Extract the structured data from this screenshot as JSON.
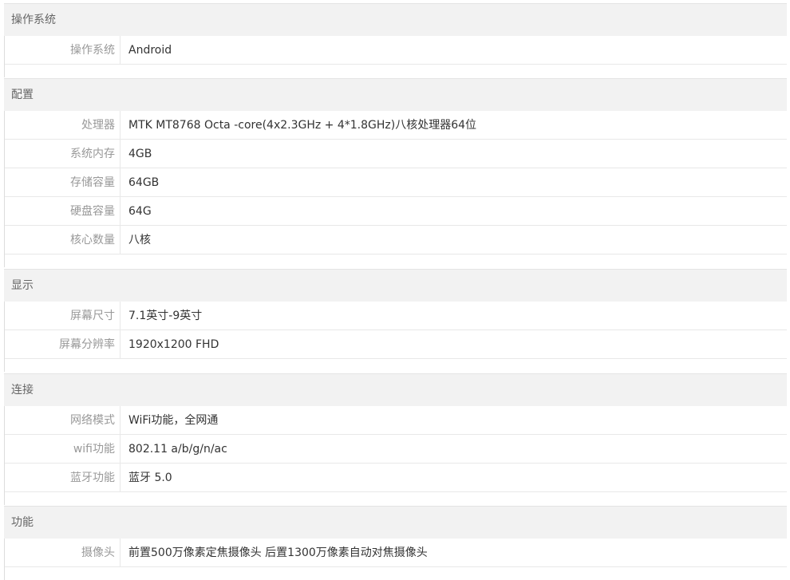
{
  "sections": [
    {
      "title": "操作系统",
      "rows": [
        {
          "label": "操作系统",
          "value": "Android"
        }
      ]
    },
    {
      "title": "配置",
      "rows": [
        {
          "label": "处理器",
          "value": "MTK MT8768 Octa -core(4x2.3GHz + 4*1.8GHz)八核处理器64位"
        },
        {
          "label": "系统内存",
          "value": "4GB"
        },
        {
          "label": "存储容量",
          "value": "64GB"
        },
        {
          "label": "硬盘容量",
          "value": "64G"
        },
        {
          "label": "核心数量",
          "value": "八核"
        }
      ]
    },
    {
      "title": "显示",
      "rows": [
        {
          "label": "屏幕尺寸",
          "value": "7.1英寸-9英寸"
        },
        {
          "label": "屏幕分辨率",
          "value": "1920x1200 FHD"
        }
      ]
    },
    {
      "title": "连接",
      "rows": [
        {
          "label": "网络模式",
          "value": "WiFi功能，全网通"
        },
        {
          "label": "wifi功能",
          "value": "802.11 a/b/g/n/ac"
        },
        {
          "label": "蓝牙功能",
          "value": "蓝牙 5.0"
        }
      ]
    },
    {
      "title": "功能",
      "rows": [
        {
          "label": "摄像头",
          "value": "前置500万像素定焦摄像头 后置1300万像素自动对焦摄像头"
        }
      ]
    }
  ]
}
